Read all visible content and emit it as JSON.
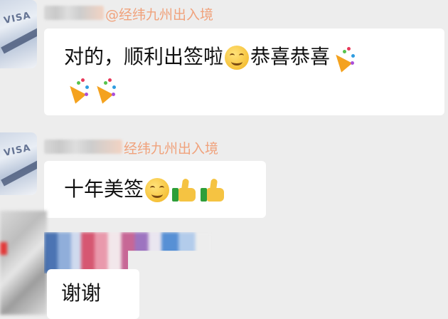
{
  "messages": [
    {
      "sender": "@经纬九州出入境",
      "segments": [
        {
          "t": "text",
          "v": "对的，顺利出签啦"
        },
        {
          "t": "icon",
          "icon": "smile-emoji"
        },
        {
          "t": "text",
          "v": "恭喜恭喜"
        },
        {
          "t": "icon",
          "icon": "party-popper-emoji"
        }
      ],
      "line2_icons": [
        "party-popper-emoji",
        "party-popper-emoji"
      ]
    },
    {
      "sender": "经纬九州出入境",
      "segments": [
        {
          "t": "text",
          "v": "十年美签"
        },
        {
          "t": "icon",
          "icon": "smile-emoji"
        },
        {
          "t": "icon",
          "icon": "thumbs-up-emoji"
        },
        {
          "t": "icon",
          "icon": "thumbs-up-emoji"
        }
      ]
    },
    {
      "sender": "",
      "text": "谢谢"
    }
  ],
  "colors": {
    "background": "#ededed",
    "bubble": "#ffffff",
    "sender_name": "#f0a27c"
  },
  "avatar_text": "VISA"
}
